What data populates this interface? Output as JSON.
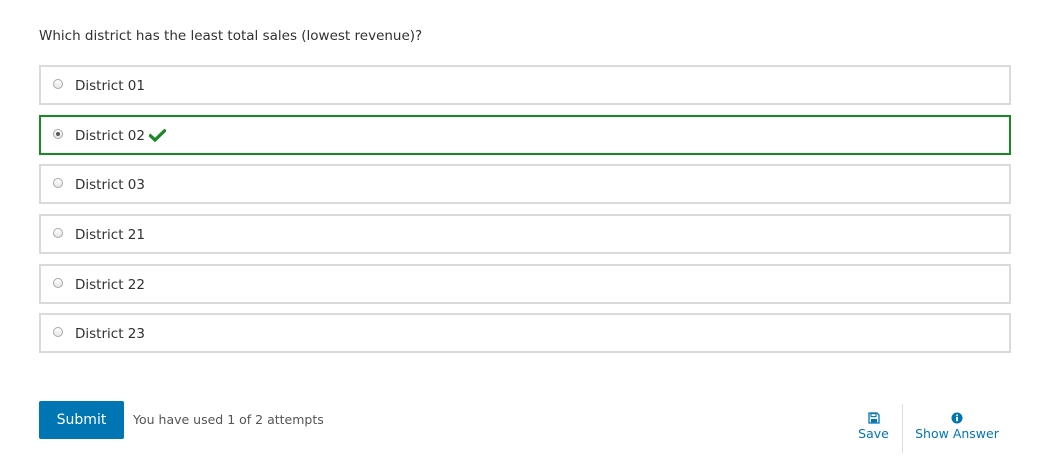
{
  "question": "Which district has the least total sales (lowest revenue)?",
  "choices": [
    {
      "label": "District 01",
      "selected": false,
      "correct": false
    },
    {
      "label": "District 02",
      "selected": true,
      "correct": true
    },
    {
      "label": "District 03",
      "selected": false,
      "correct": false
    },
    {
      "label": "District 21",
      "selected": false,
      "correct": false
    },
    {
      "label": "District 22",
      "selected": false,
      "correct": false
    },
    {
      "label": "District 23",
      "selected": false,
      "correct": false
    }
  ],
  "actions": {
    "submit_label": "Submit",
    "attempts_text": "You have used 1 of 2 attempts",
    "save_label": "Save",
    "save_icon": "floppy-disk-icon",
    "show_answer_label": "Show Answer",
    "show_answer_icon": "info-circle-icon"
  },
  "colors": {
    "accent": "#0075b4",
    "correct": "#178a22",
    "border": "#dadada"
  }
}
